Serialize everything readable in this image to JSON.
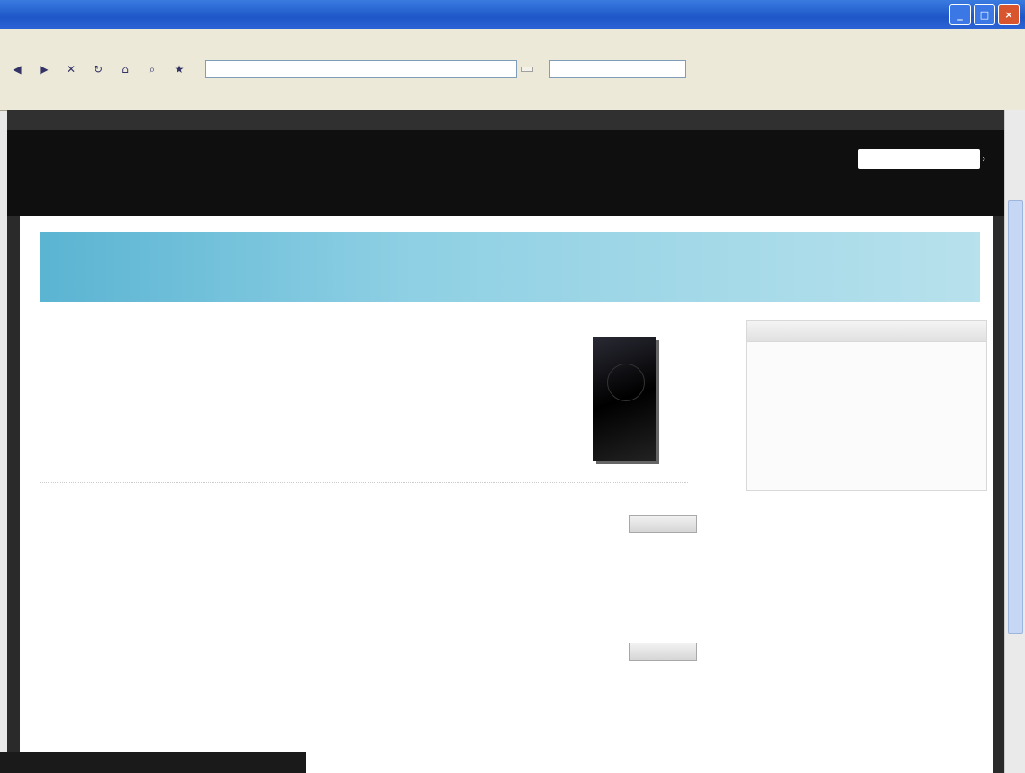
{
  "window": {
    "title": ""
  },
  "menubar": {
    "items": []
  },
  "toolbar": {
    "address": "",
    "go_label": ""
  },
  "links_bar": {
    "items": []
  },
  "site": {
    "logo": "",
    "nav": [],
    "sub_links": ""
  },
  "page": {
    "banner_title": "",
    "section_label": "",
    "description": "",
    "more_link": "",
    "sidebox_title": "",
    "sidebox_links": [],
    "download_title": "",
    "downloads": [
      {
        "file": "",
        "button": "",
        "sub_title": "",
        "links": []
      },
      {
        "file": "",
        "button": "",
        "sub_title": "",
        "links": []
      }
    ]
  },
  "status": {
    "text": ""
  }
}
